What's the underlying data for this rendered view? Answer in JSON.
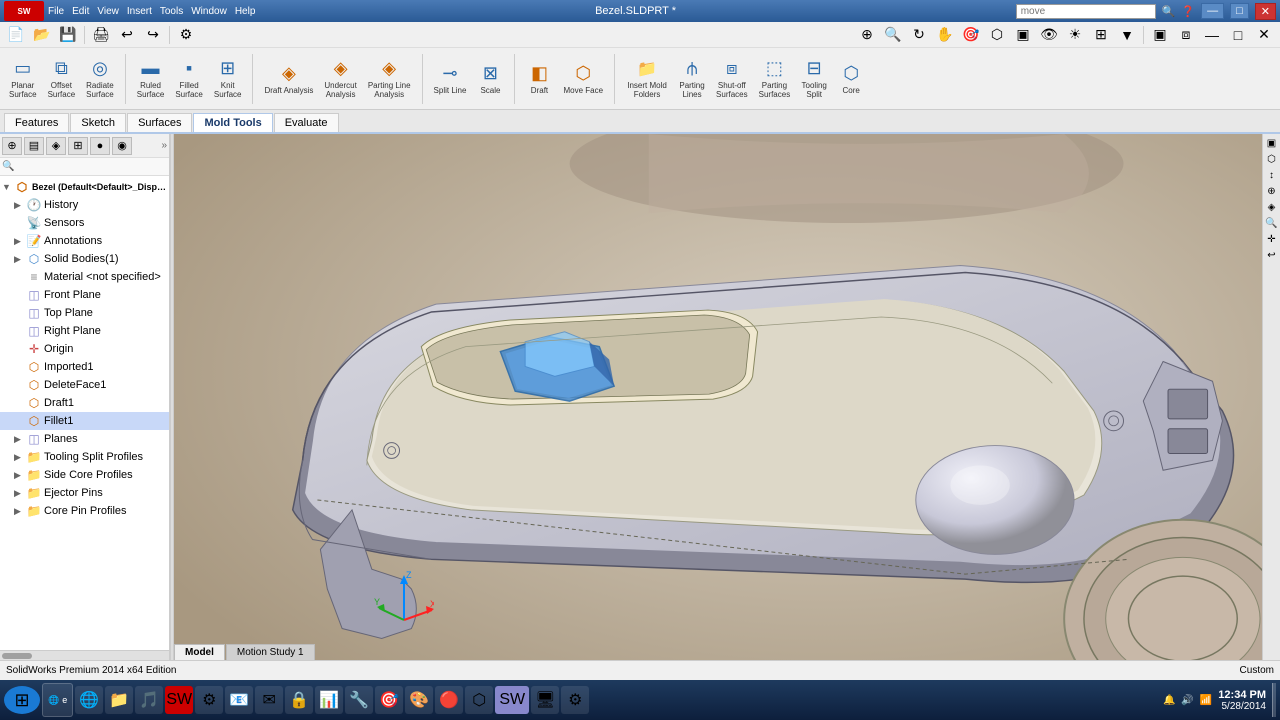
{
  "titleBar": {
    "logo": "SW",
    "title": "Bezel.SLDPRT *",
    "searchPlaceholder": "move",
    "controls": [
      "—",
      "□",
      "✕"
    ]
  },
  "menuBar": {
    "items": [
      "File",
      "Edit",
      "View",
      "Insert",
      "Tools",
      "Window",
      "Help"
    ]
  },
  "toolbar": {
    "row1": {
      "buttons": [
        "▣",
        "◨",
        "⧉",
        "⊞",
        "⊡",
        "◉",
        "▦"
      ]
    },
    "surfaceTools": [
      {
        "label": "Planar\nSurface",
        "icon": "▭"
      },
      {
        "label": "Offset\nSurface",
        "icon": "⧉"
      },
      {
        "label": "Radiate\nSurface",
        "icon": "◎"
      },
      {
        "label": "Ruled\nSurface",
        "icon": "▬"
      },
      {
        "label": "Filled\nSurface",
        "icon": "▪"
      },
      {
        "label": "Knit\nSurface",
        "icon": "⊞"
      },
      {
        "label": "Draft\nAnalysis",
        "icon": "◈"
      },
      {
        "label": "Undercut\nAnalysis",
        "icon": "◈"
      },
      {
        "label": "Parting Line\nAnalysis",
        "icon": "◈"
      },
      {
        "label": "Split\nLine",
        "icon": "⊸"
      },
      {
        "label": "Scale",
        "icon": "⊠"
      },
      {
        "label": "Draft",
        "icon": "◧"
      },
      {
        "label": "Move\nFace",
        "icon": "⬡"
      },
      {
        "label": "Insert Mold\nFolders",
        "icon": "📁"
      },
      {
        "label": "Parting\nLines",
        "icon": "⫛"
      },
      {
        "label": "Shut-off\nSurfaces",
        "icon": "⧈"
      },
      {
        "label": "Parting\nSurfaces",
        "icon": "⬚"
      },
      {
        "label": "Tooling\nSplit",
        "icon": "⊟"
      },
      {
        "label": "Core",
        "icon": "⬡"
      }
    ]
  },
  "tabs": {
    "items": [
      "Features",
      "Sketch",
      "Surfaces",
      "Mold Tools",
      "Evaluate"
    ],
    "active": "Mold Tools"
  },
  "featureTree": {
    "root": "Bezel (Default<Default>_Display)",
    "items": [
      {
        "label": "History",
        "icon": "🕐",
        "expandable": true,
        "depth": 1
      },
      {
        "label": "Sensors",
        "icon": "📡",
        "expandable": false,
        "depth": 1
      },
      {
        "label": "Annotations",
        "icon": "📝",
        "expandable": false,
        "depth": 1
      },
      {
        "label": "Solid Bodies(1)",
        "icon": "⬡",
        "expandable": false,
        "depth": 1
      },
      {
        "label": "Material <not specified>",
        "icon": "⬡",
        "expandable": false,
        "depth": 1
      },
      {
        "label": "Front Plane",
        "icon": "◫",
        "expandable": false,
        "depth": 1
      },
      {
        "label": "Top Plane",
        "icon": "◫",
        "expandable": false,
        "depth": 1
      },
      {
        "label": "Right Plane",
        "icon": "◫",
        "expandable": false,
        "depth": 1
      },
      {
        "label": "Origin",
        "icon": "✛",
        "expandable": false,
        "depth": 1
      },
      {
        "label": "Imported1",
        "icon": "⬡",
        "expandable": false,
        "depth": 1
      },
      {
        "label": "DeleteFace1",
        "icon": "⬡",
        "expandable": false,
        "depth": 1
      },
      {
        "label": "Draft1",
        "icon": "⬡",
        "expandable": false,
        "depth": 1
      },
      {
        "label": "Fillet1",
        "icon": "⬡",
        "expandable": false,
        "depth": 1,
        "selected": true
      },
      {
        "label": "Planes",
        "icon": "◫",
        "expandable": true,
        "depth": 1
      },
      {
        "label": "Tooling Split Profiles",
        "icon": "📁",
        "expandable": true,
        "depth": 1
      },
      {
        "label": "Side Core Profiles",
        "icon": "📁",
        "expandable": true,
        "depth": 1
      },
      {
        "label": "Ejector Pins",
        "icon": "📁",
        "expandable": true,
        "depth": 1
      },
      {
        "label": "Core Pin Profiles",
        "icon": "📁",
        "expandable": true,
        "depth": 1
      }
    ]
  },
  "statusBar": {
    "text": "SolidWorks Premium 2014 x64 Edition",
    "custom": "Custom"
  },
  "bottomTabs": [
    "Model",
    "Motion Study 1"
  ],
  "activeBottomTab": "Model",
  "taskbar": {
    "time": "12:34 PM",
    "date": "5/28/2014",
    "apps": [
      "⊞",
      "e",
      "🗂",
      "📁",
      "🎵",
      "⚙",
      "📧",
      "✉",
      "🔒",
      "🌐",
      "🔔",
      "📊",
      "🔧",
      "🎯",
      "🎮",
      "⬡",
      "SW",
      "🔴",
      "🖥",
      "⚙"
    ]
  }
}
